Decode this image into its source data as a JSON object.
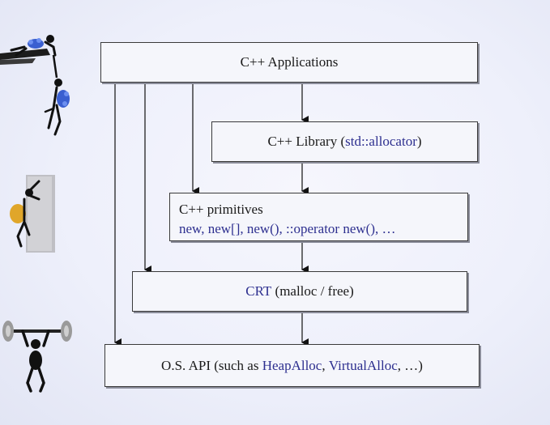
{
  "diagram": {
    "apps": {
      "label": "C++ Applications"
    },
    "library": {
      "prefix": "C++ Library (",
      "highlight": "std::allocator",
      "suffix": ")"
    },
    "primitives": {
      "title": "C++ primitives",
      "items": "new, new[], new(), ::operator new(), …"
    },
    "crt": {
      "highlight": "CRT",
      "rest": " (malloc / free)"
    },
    "os": {
      "prefix": "O.S. API (such as ",
      "highlight1": "HeapAlloc",
      "sep": ", ",
      "highlight2": "VirtualAlloc",
      "suffix": ", …)"
    }
  },
  "colors": {
    "background": "#eef0fb",
    "box_fill": "#f5f6fb",
    "border": "#3a3a3a",
    "highlight_text": "#2d2f8f"
  },
  "icons": [
    "climbers-icon",
    "rock-climber-icon",
    "weightlifter-icon"
  ]
}
